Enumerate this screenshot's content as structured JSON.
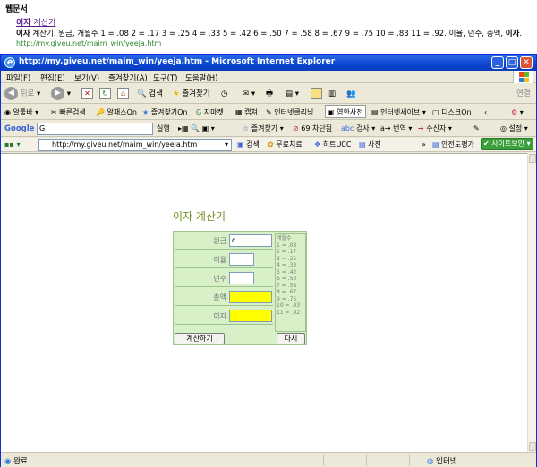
{
  "result": {
    "section": "웹문서",
    "title_main": "이자",
    "title_rest": " 계산기",
    "snippet_b1": "이자",
    "snippet_text": " 계산기. 원금, 개월수 1 = .08 2 = .17 3 = .25 4 = .33 5 = .42 6 = .50 7 = .58 8 = .67 9 = .75 10 = .83 11 = .92. 이율, 년수, 총액, ",
    "snippet_b2": "이자",
    "snippet_end": ".",
    "url": "http://my.giveu.net/maim_win/yeeja.htm"
  },
  "window": {
    "title": "http://my.giveu.net/maim_win/yeeja.htm - Microsoft Internet Explorer",
    "min": "_",
    "max": "□",
    "close": "✕"
  },
  "menu": [
    "파일(F)",
    "편집(E)",
    "보기(V)",
    "즐겨찾기(A)",
    "도구(T)",
    "도움말(H)"
  ],
  "toolbar": {
    "back": "뒤로",
    "search": "검색",
    "favorites": "즐겨찾기",
    "links": "연결"
  },
  "toolbar2": {
    "items": [
      "알툴바",
      "빠른검색",
      "알패스On",
      "즐겨찾기On",
      "지마켓",
      "캡쳐",
      "인터넷클리닝",
      "영한사전",
      "인터넷세이브",
      "디스크On"
    ],
    "settings": "⚙"
  },
  "toolbar3": {
    "google": "Google",
    "g_input": "G",
    "run": "실행",
    "fav": "즐겨찾기",
    "block": "69 차단됨",
    "check": "검사",
    "translate": "번역",
    "receiver": "수신자",
    "settings": "설정"
  },
  "toolbar4": {
    "address": "http://my.giveu.net/maim_win/yeeja.htm",
    "search": "검색",
    "free": "무료치료",
    "ucc": "히트UCC",
    "dict": "사전",
    "safe": "안전도평가",
    "site_security": "사이트보안"
  },
  "calc": {
    "title": "이자 계산기",
    "labels": {
      "principal": "원금",
      "rate": "이율",
      "years": "년수",
      "total": "총액",
      "interest": "이자"
    },
    "principal_value": "c",
    "rate_table": {
      "heading": "개월수",
      "rows": [
        "1 = .08",
        "2 = .17",
        "3 = .25",
        "4 = .33",
        "5 = .42",
        "6 = .50",
        "7 = .58",
        "8 = .67",
        "9 = .75",
        "10 = .83",
        "11 = .92"
      ]
    },
    "calc_button": "계산하기",
    "reset_button": "다시"
  },
  "status": {
    "done": "완료",
    "zone": "인터넷"
  }
}
